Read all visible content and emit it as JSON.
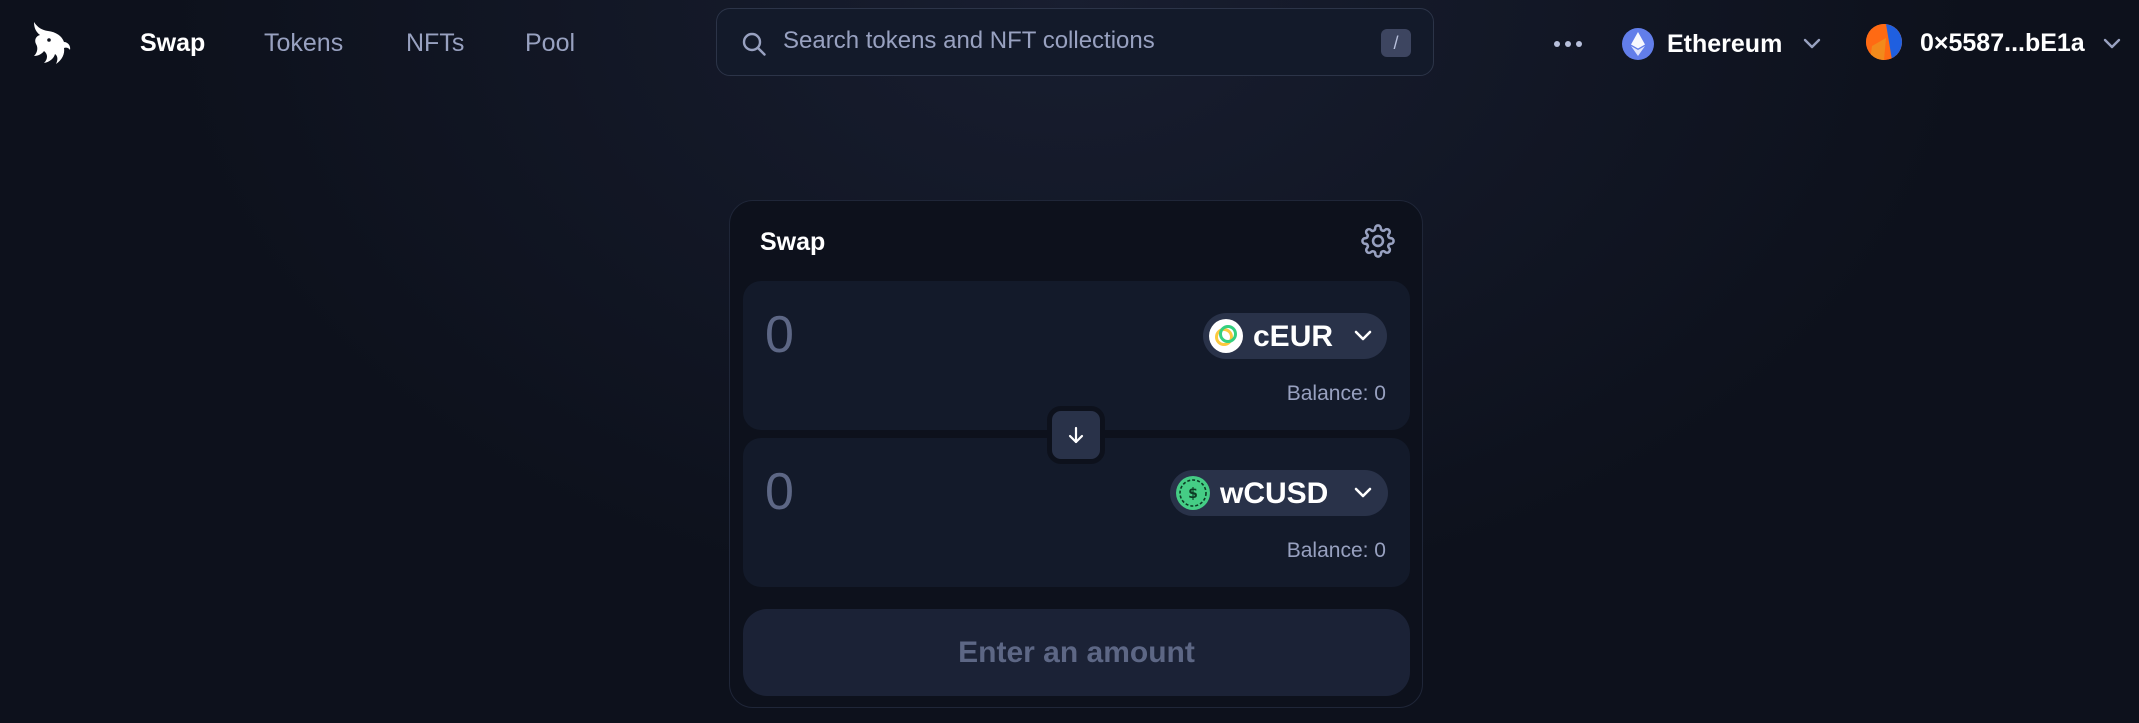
{
  "nav": {
    "items": [
      {
        "label": "Swap",
        "active": true
      },
      {
        "label": "Tokens",
        "active": false
      },
      {
        "label": "NFTs",
        "active": false
      },
      {
        "label": "Pool",
        "active": false
      }
    ]
  },
  "search": {
    "placeholder": "Search tokens and NFT collections",
    "value": "",
    "shortcut_key": "/"
  },
  "more_menu_icon": "ellipsis-icon",
  "network": {
    "label": "Ethereum",
    "icon": "ethereum-icon"
  },
  "account": {
    "address": "0×5587...bE1a",
    "icon": "wallet-avatar-icon"
  },
  "swap": {
    "title": "Swap",
    "settings_icon": "gear-icon",
    "input": {
      "amount_placeholder": "0",
      "amount_value": "",
      "token_symbol": "cEUR",
      "token_icon": "celo-euro-icon",
      "balance_text": "Balance: 0"
    },
    "output": {
      "amount_placeholder": "0",
      "amount_value": "",
      "token_symbol": "wCUSD",
      "token_icon": "wrapped-celo-dollar-icon",
      "balance_text": "Balance: 0"
    },
    "switch_icon": "arrow-down-icon",
    "action_label": "Enter an amount"
  },
  "colors": {
    "background": "#0d111c",
    "panel": "#131a2a",
    "token_pill": "#293249",
    "muted_text": "#98a1c0",
    "placeholder_text": "#5d6785",
    "ethereum": "#627eea"
  }
}
